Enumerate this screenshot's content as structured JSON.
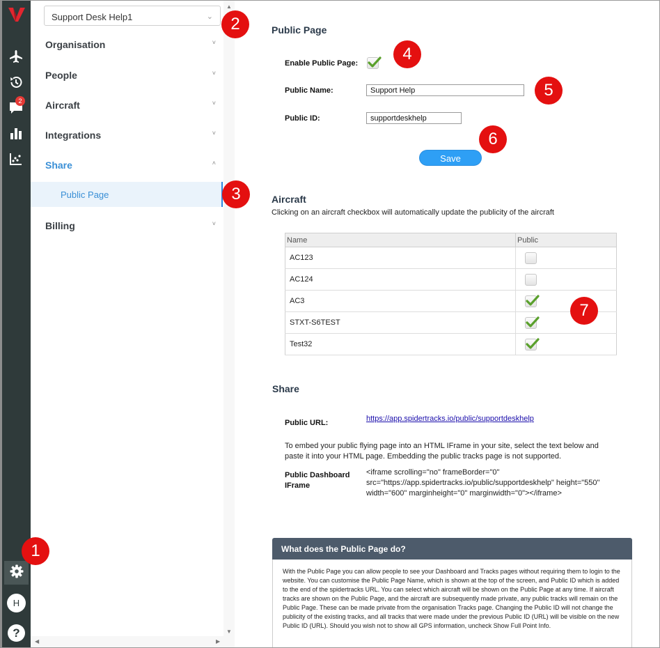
{
  "org_selector": {
    "value": "Support Desk Help1"
  },
  "rail": {
    "icons": [
      "logo-icon",
      "plane-icon",
      "history-icon",
      "messages-icon",
      "bar-chart-icon",
      "scatter-chart-icon"
    ],
    "message_badge": "2",
    "settings_icon": "gear-icon",
    "avatar_initial": "H",
    "help_label": "?"
  },
  "nav": {
    "items": [
      {
        "label": "Organisation"
      },
      {
        "label": "People"
      },
      {
        "label": "Aircraft"
      },
      {
        "label": "Integrations"
      },
      {
        "label": "Share"
      },
      {
        "label": "Billing"
      }
    ],
    "sub_item": "Public Page",
    "chevron_down": "˅",
    "chevron_up": "˄"
  },
  "markers": [
    "1",
    "2",
    "3",
    "4",
    "5",
    "6",
    "7"
  ],
  "public_page": {
    "title": "Public Page",
    "enable_label": "Enable Public Page:",
    "enabled": true,
    "name_label": "Public Name:",
    "name_value": "Support Help",
    "id_label": "Public ID:",
    "id_value": "supportdeskhelp",
    "save_label": "Save"
  },
  "aircraft": {
    "title": "Aircraft",
    "description": "Clicking on an aircraft checkbox will automatically update the publicity of the aircraft",
    "columns": [
      "Name",
      "Public"
    ],
    "rows": [
      {
        "name": "AC123",
        "public": false
      },
      {
        "name": "AC124",
        "public": false
      },
      {
        "name": "AC3",
        "public": true
      },
      {
        "name": "STXT-S6TEST",
        "public": true
      },
      {
        "name": "Test32",
        "public": true
      }
    ]
  },
  "share": {
    "title": "Share",
    "url_label": "Public URL:",
    "url": "https://app.spidertracks.io/public/supportdeskhelp",
    "embed_text": "To embed your public flying page into an HTML IFrame in your site, select the text below and paste it into your HTML page. Embedding the public tracks page is not supported.",
    "iframe_label": "Public Dashboard IFrame",
    "iframe_code": "<iframe scrolling=\"no\" frameBorder=\"0\" src=\"https://app.spidertracks.io/public/supportdeskhelp\" height=\"550\" width=\"600\" marginheight=\"0\" marginwidth=\"0\"></iframe>"
  },
  "info": {
    "title": "What does the Public Page do?",
    "body": "With the Public Page you can allow people to see your Dashboard and Tracks pages without requiring them to login to the website. You can customise the Public Page Name, which is shown at the top of the screen, and Public ID which is added to the end of the spidertracks URL. You can select which aircraft will be shown on the Public Page at any time. If aircraft tracks are shown on the Public Page, and the aircraft are subsequently made private, any public tracks will remain on the Public Page. These can be made private from the organisation Tracks page. Changing the Public ID will not change the publicity of the existing tracks, and all tracks that were made under the previous Public ID (URL) will be visible on the new Public ID (URL). Should you wish not to show all GPS information, uncheck Show Full Point Info."
  },
  "colors": {
    "rail": "#2f3a3a",
    "accent": "#3a8fd6",
    "marker": "#e41010",
    "button": "#2e9ff5",
    "check": "#5aa02c"
  }
}
